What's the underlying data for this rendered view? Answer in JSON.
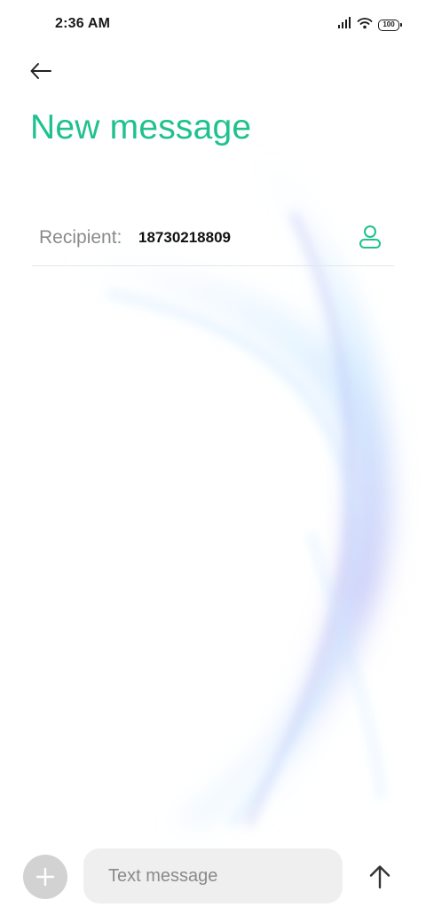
{
  "status_bar": {
    "time": "2:36 AM",
    "battery_level": "100",
    "icons": [
      "signal-icon",
      "wifi-icon",
      "battery-icon"
    ]
  },
  "header": {
    "back_icon": "back-arrow-icon",
    "title": "New message"
  },
  "recipient": {
    "label": "Recipient:",
    "value": "18730218809",
    "contact_icon": "contact-person-icon"
  },
  "composer": {
    "attach_icon": "plus-icon",
    "placeholder": "Text message",
    "value": "",
    "send_icon": "arrow-up-icon"
  },
  "colors": {
    "accent": "#1fc18e",
    "label_gray": "#8a8a8a",
    "input_bg": "#efefef",
    "attach_bg": "#d2d2d2"
  }
}
